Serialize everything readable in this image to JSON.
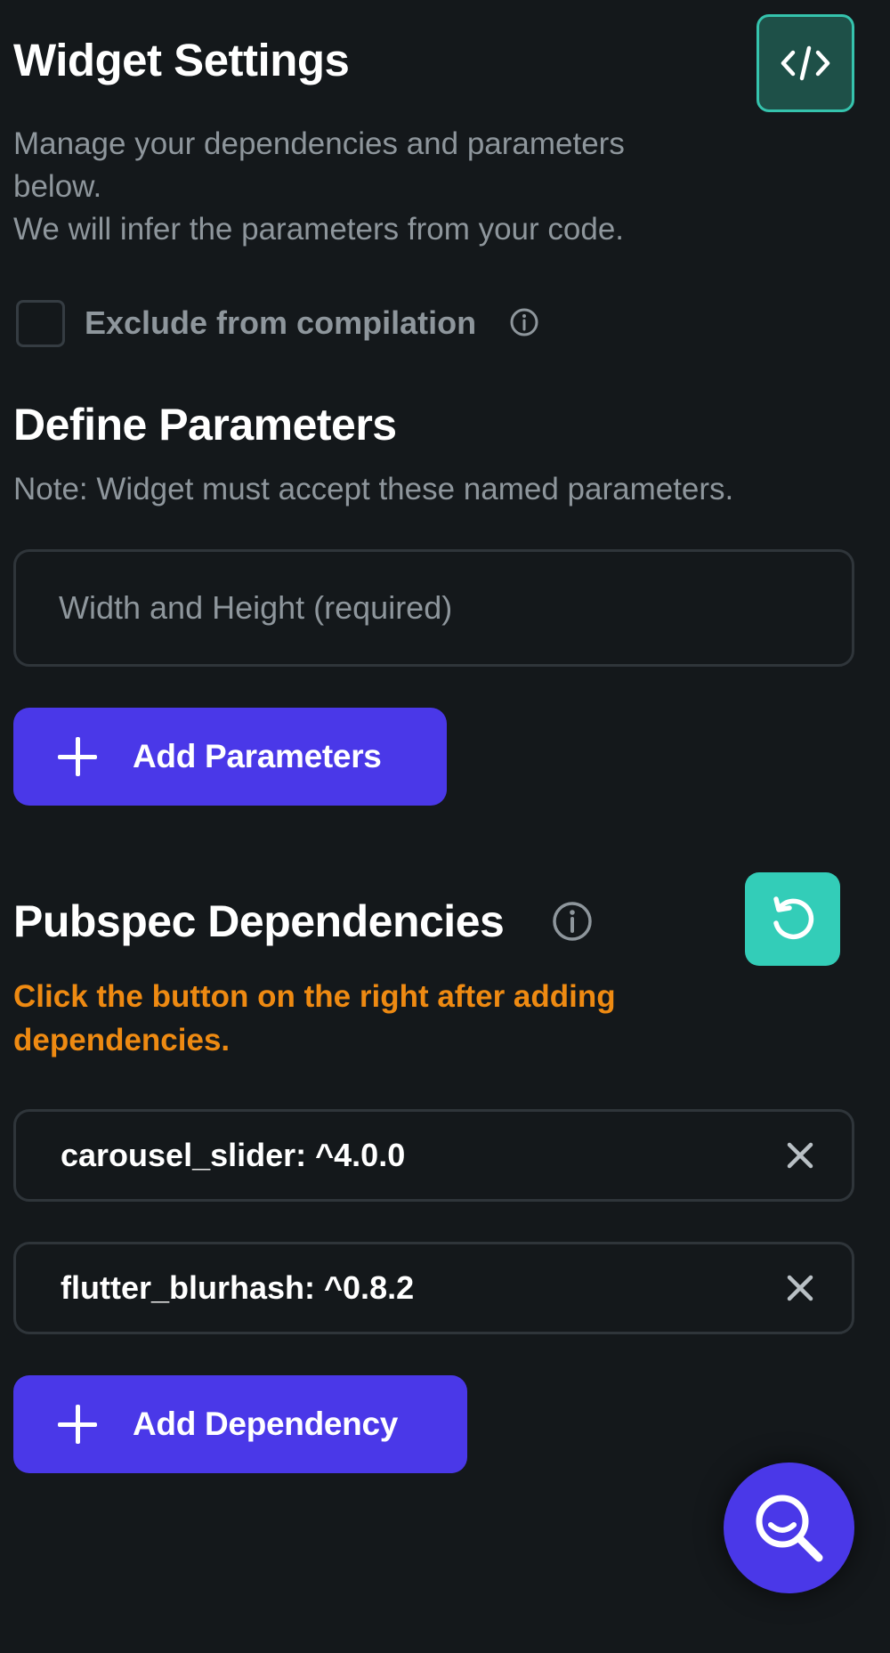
{
  "header": {
    "title": "Widget Settings",
    "description_lines": [
      "Manage your dependencies and parameters",
      "below.",
      "We will infer the parameters from your code."
    ],
    "code_button_icon": "code-icon"
  },
  "exclude": {
    "label": "Exclude from compilation",
    "checked": false,
    "icon": "info-icon"
  },
  "parameters": {
    "heading": "Define Parameters",
    "note": "Note: Widget must accept these named parameters.",
    "input_placeholder": "Width and Height (required)",
    "input_value": "",
    "add_button_label": "Add Parameters"
  },
  "dependencies": {
    "heading": "Pubspec Dependencies",
    "heading_icon": "info-icon",
    "refresh_icon": "refresh-icon",
    "warning_lines": [
      "Click the button on the right after adding",
      "dependencies."
    ],
    "items": [
      {
        "label": "carousel_slider: ^4.0.0"
      },
      {
        "label": "flutter_blurhash: ^0.8.2"
      }
    ],
    "add_button_label": "Add Dependency"
  },
  "fab": {
    "icon": "search-icon"
  },
  "colors": {
    "background": "#14181b",
    "primary": "#4a38e8",
    "teal": "#33cdb8",
    "warning": "#ee8a12",
    "muted_text": "#8e969c"
  }
}
